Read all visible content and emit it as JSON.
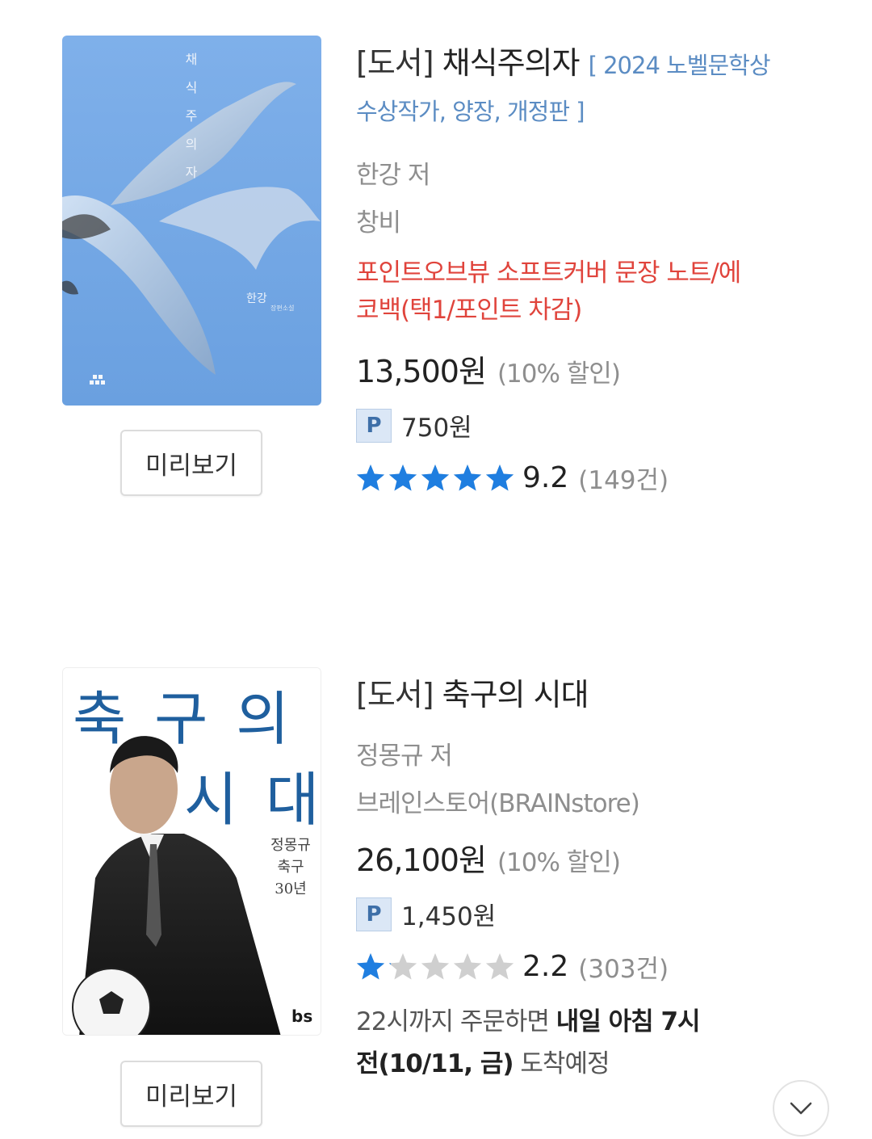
{
  "products": [
    {
      "cover_title": "채식주의자",
      "cover_author": "한강",
      "cover_subtitle": "장편소설",
      "preview_label": "미리보기",
      "category": "[도서]",
      "title": "채식주의자",
      "subtitle_line1": "[ 2024 노벨문학상",
      "subtitle_line2": "수상작가, 양장, 개정판 ]",
      "author": "한강 저",
      "publisher": "창비",
      "promo_line1": "포인트오브뷰 소프트커버 문장 노트/에",
      "promo_line2": "코백(택1/포인트 차감)",
      "price": "13,500원",
      "discount": "(10% 할인)",
      "point_badge": "P",
      "points": "750원",
      "rating_fraction": 1.0,
      "rating": "9.2",
      "reviews": "(149건)"
    },
    {
      "cover_title_line1": "축 구 의",
      "cover_title_line2": "시   대",
      "cover_side_1": "정몽규",
      "cover_side_2": "축구",
      "cover_side_3": "30년",
      "cover_logo": "bs",
      "preview_label": "미리보기",
      "category": "[도서]",
      "title": "축구의 시대",
      "author": "정몽규 저",
      "publisher": "브레인스토어(BRAINstore)",
      "price": "26,100원",
      "discount": "(10% 할인)",
      "point_badge": "P",
      "points": "1,450원",
      "rating_fraction": 0.22,
      "rating": "2.2",
      "reviews": "(303건)",
      "delivery_pre": "22시까지 주문하면 ",
      "delivery_bold": "내일 아침 7시",
      "delivery_bold2": "전(10/11, 금)",
      "delivery_post": " 도착예정"
    }
  ],
  "colors": {
    "accent_blue": "#5b8cc3",
    "promo_red": "#e0443c",
    "star_blue": "#1f7ee0",
    "star_gray": "#cfcfcf"
  },
  "icons": {
    "chevron": "chevron-down-icon"
  }
}
